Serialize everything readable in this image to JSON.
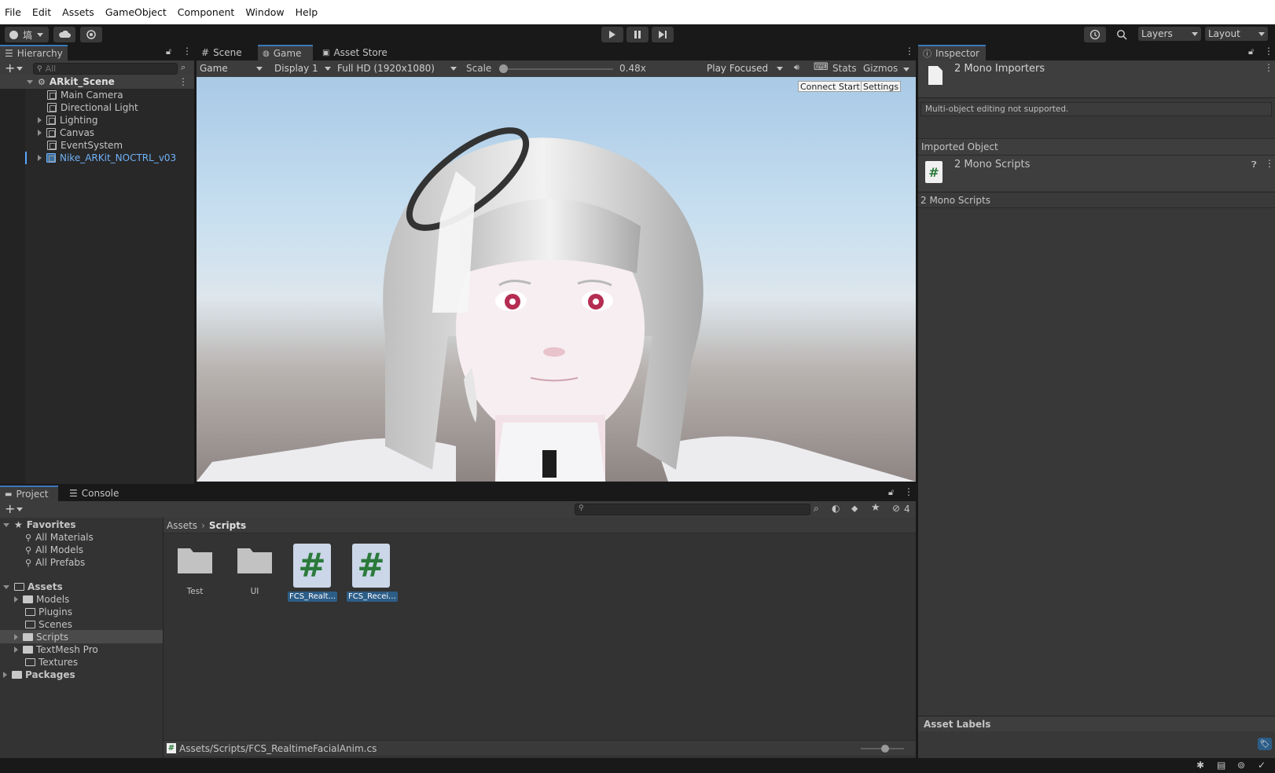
{
  "menu": [
    "File",
    "Edit",
    "Assets",
    "GameObject",
    "Component",
    "Window",
    "Help"
  ],
  "toolbar": {
    "account_label": "塙",
    "layers_label": "Layers",
    "layout_label": "Layout"
  },
  "hierarchy": {
    "tab": "Hierarchy",
    "search_placeholder": "All",
    "scene": "ARkit_Scene",
    "items": [
      "Main Camera",
      "Directional Light",
      "Lighting",
      "Canvas",
      "EventSystem",
      "Nike_ARKit_NOCTRL_v03"
    ]
  },
  "center_tabs": [
    "Scene",
    "Game",
    "Asset Store"
  ],
  "game_toolbar": {
    "mode": "Game",
    "display": "Display 1",
    "resolution": "Full HD (1920x1080)",
    "scale_label": "Scale",
    "scale_value": "0.48x",
    "scale_fraction": 0.0,
    "play_mode": "Play Focused",
    "stats": "Stats",
    "gizmos": "Gizmos"
  },
  "game_overlay": {
    "connect": "Connect Start",
    "settings": "Settings"
  },
  "inspector": {
    "tab": "Inspector",
    "title": "2 Mono Importers",
    "warning": "Multi-object editing not supported.",
    "imported_header": "Imported Object",
    "imported_title": "2 Mono Scripts",
    "section": "2 Mono Scripts",
    "asset_labels": "Asset Labels"
  },
  "bottom_tabs": [
    "Project",
    "Console"
  ],
  "project": {
    "favorites": "Favorites",
    "fav_items": [
      "All Materials",
      "All Models",
      "All Prefabs"
    ],
    "assets": "Assets",
    "asset_folders": [
      "Models",
      "Plugins",
      "Scenes",
      "Scripts",
      "TextMesh Pro",
      "Textures"
    ],
    "packages": "Packages",
    "breadcrumb": [
      "Assets",
      "Scripts"
    ],
    "hidden_count": "4",
    "files": [
      {
        "name": "Test",
        "type": "folder"
      },
      {
        "name": "UI",
        "type": "folder"
      },
      {
        "name": "FCS_Realt...",
        "type": "script"
      },
      {
        "name": "FCS_Recei...",
        "type": "script"
      }
    ],
    "status_path": "Assets/Scripts/FCS_RealtimeFacialAnim.cs"
  },
  "colors": {
    "accent": "#3a79bb",
    "script_hash": "#2b7a3b",
    "selected_blue": "#2c5d87",
    "link_blue": "#58a6ff"
  }
}
